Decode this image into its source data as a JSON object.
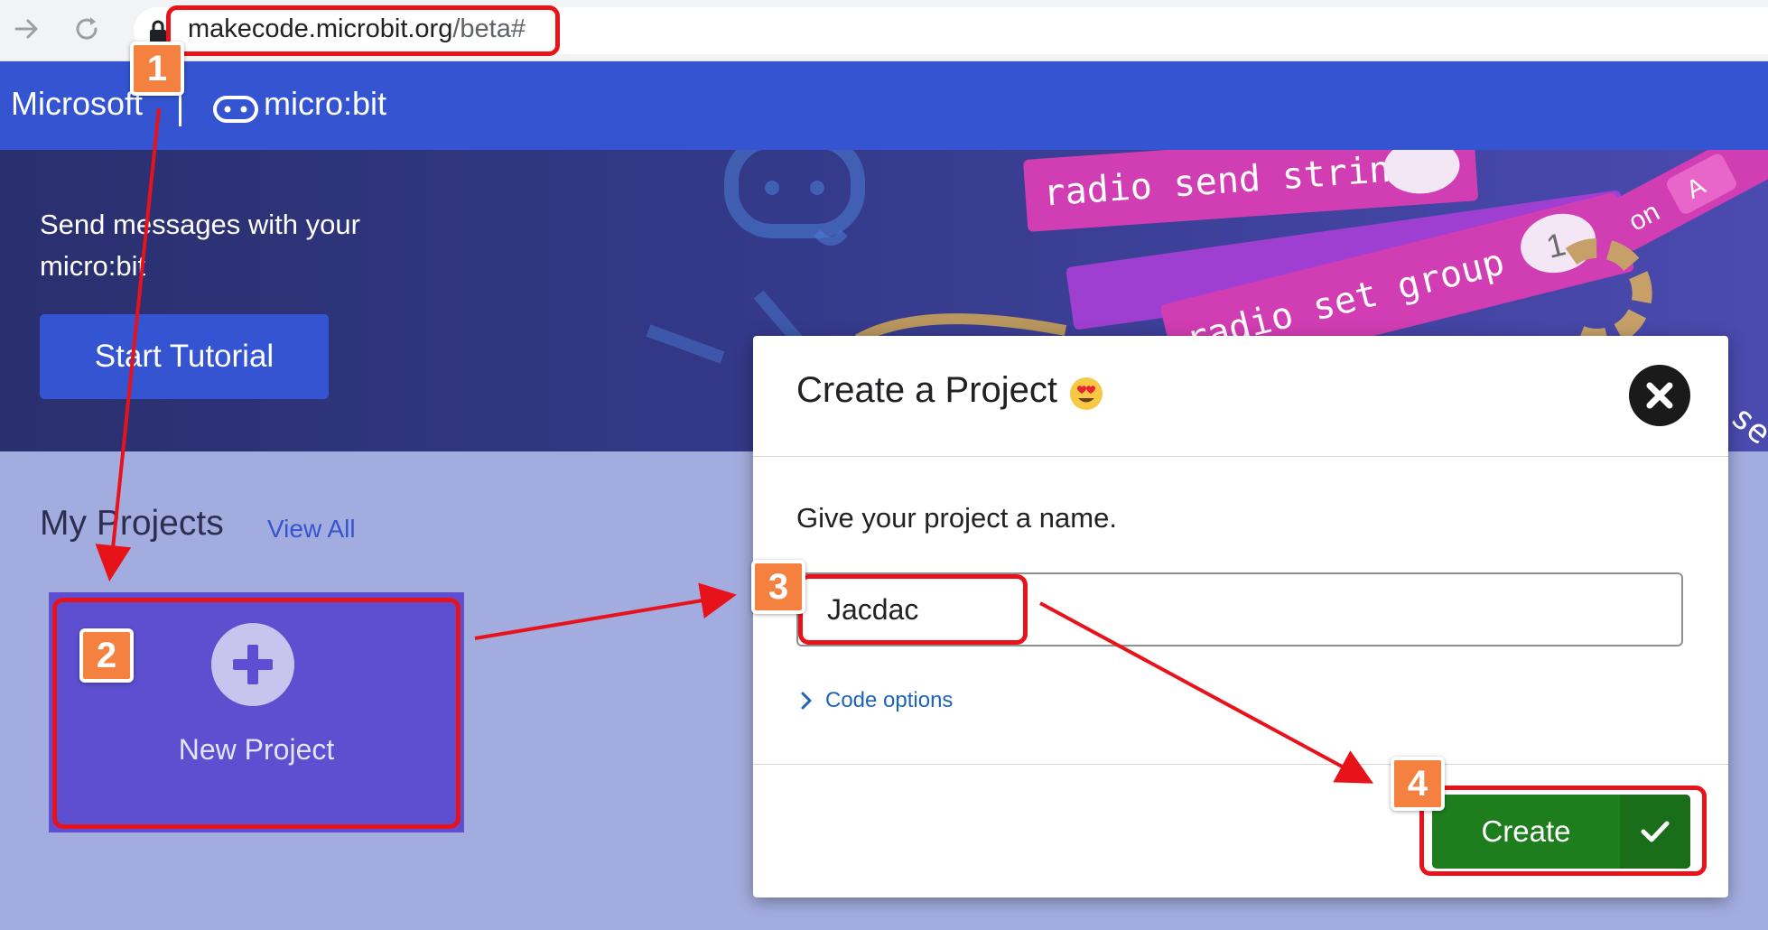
{
  "browser": {
    "url_host": "makecode.microbit.org",
    "url_path": "/beta#",
    "back_icon": "arrow-right-icon",
    "reload_icon": "reload-icon",
    "lock_icon": "lock-icon"
  },
  "header": {
    "brand": "Microsoft",
    "product": "micro:bit"
  },
  "hero": {
    "text": "Send messages with your micro:bit",
    "button_label": "Start Tutorial",
    "blocks": [
      "radio send string",
      "radio set group",
      "1",
      "A",
      "on",
      "se"
    ]
  },
  "projects": {
    "title": "My Projects",
    "view_all": "View All",
    "new_project": "New Project"
  },
  "dialog": {
    "title": "Create a Project",
    "prompt": "Give your project a name.",
    "name_value": "Jacdac",
    "code_options": "Code options",
    "create_label": "Create"
  },
  "annotations": {
    "steps": [
      "1",
      "2",
      "3",
      "4"
    ],
    "highlight_color": "#e8121b",
    "badge_color": "#f4813f"
  },
  "colors": {
    "header": "#3454d1",
    "create_button": "#1e7e1e",
    "new_project_tile": "#5d4fcf",
    "page_bg": "#a3acde"
  }
}
